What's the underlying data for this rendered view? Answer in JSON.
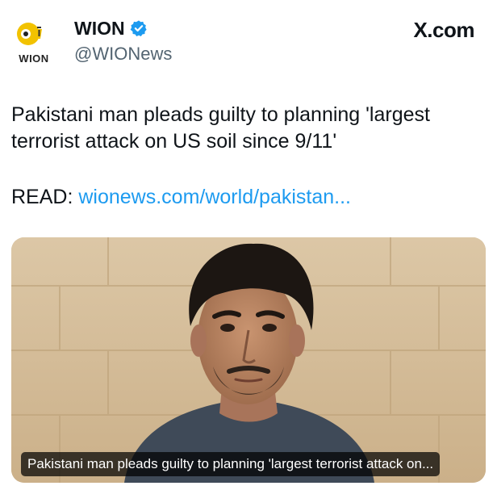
{
  "account": {
    "avatar_label": "WION",
    "display_name": "WION",
    "handle": "@WIONews",
    "verified_icon": "verified-badge-icon"
  },
  "brand": {
    "logo_text": "X.com"
  },
  "post": {
    "text": "Pakistani man pleads guilty to planning 'largest terrorist attack on US soil since 9/11'",
    "read_label": "READ:",
    "link_text": "wionews.com/world/pakistan..."
  },
  "media": {
    "caption": "Pakistani man pleads guilty to planning 'largest terrorist attack on..."
  },
  "colors": {
    "link": "#1d9bf0",
    "verified": "#1d9bf0",
    "text": "#0f1419",
    "secondary": "#536471",
    "avatar_yellow": "#f2c200"
  }
}
